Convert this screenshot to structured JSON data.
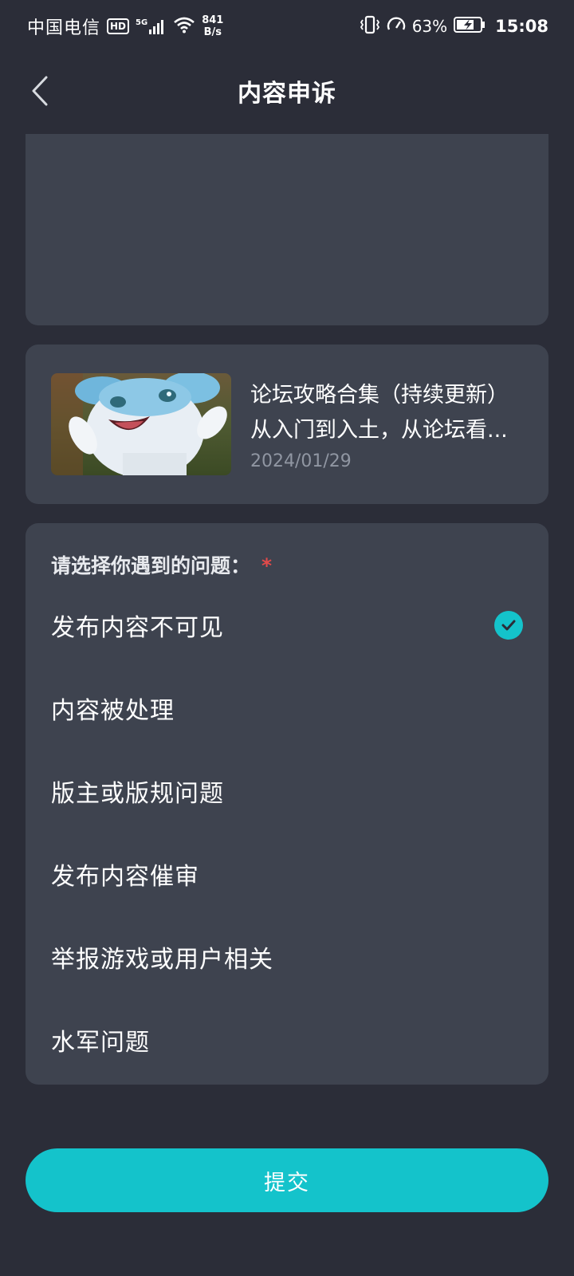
{
  "status_bar": {
    "carrier": "中国电信",
    "hd_badge": "HD",
    "network_type": "5G",
    "net_speed_value": "841",
    "net_speed_unit": "B/s",
    "battery_percent": "63%",
    "time": "15:08",
    "icons": [
      "signal-icon",
      "wifi-icon",
      "vibrate-icon",
      "speedometer-icon",
      "battery-charging-icon"
    ]
  },
  "header": {
    "title": "内容申诉",
    "back_icon": "chevron-left-icon"
  },
  "post": {
    "title_line1": "论坛攻略合集（持续更新）",
    "title_line2": "从入门到入土，从论坛看...",
    "date": "2024/01/29"
  },
  "issue": {
    "question": "请选择你遇到的问题：",
    "required_mark": "*",
    "options": [
      {
        "label": "发布内容不可见",
        "selected": true
      },
      {
        "label": "内容被处理",
        "selected": false
      },
      {
        "label": "版主或版规问题",
        "selected": false
      },
      {
        "label": "发布内容催审",
        "selected": false
      },
      {
        "label": "举报游戏或用户相关",
        "selected": false
      },
      {
        "label": "水军问题",
        "selected": false
      }
    ]
  },
  "submit": {
    "label": "提交"
  },
  "colors": {
    "background": "#2b2d38",
    "card": "#3e434f",
    "accent": "#14c3cb",
    "required": "#e24a4a",
    "muted_text": "#9096a2"
  }
}
